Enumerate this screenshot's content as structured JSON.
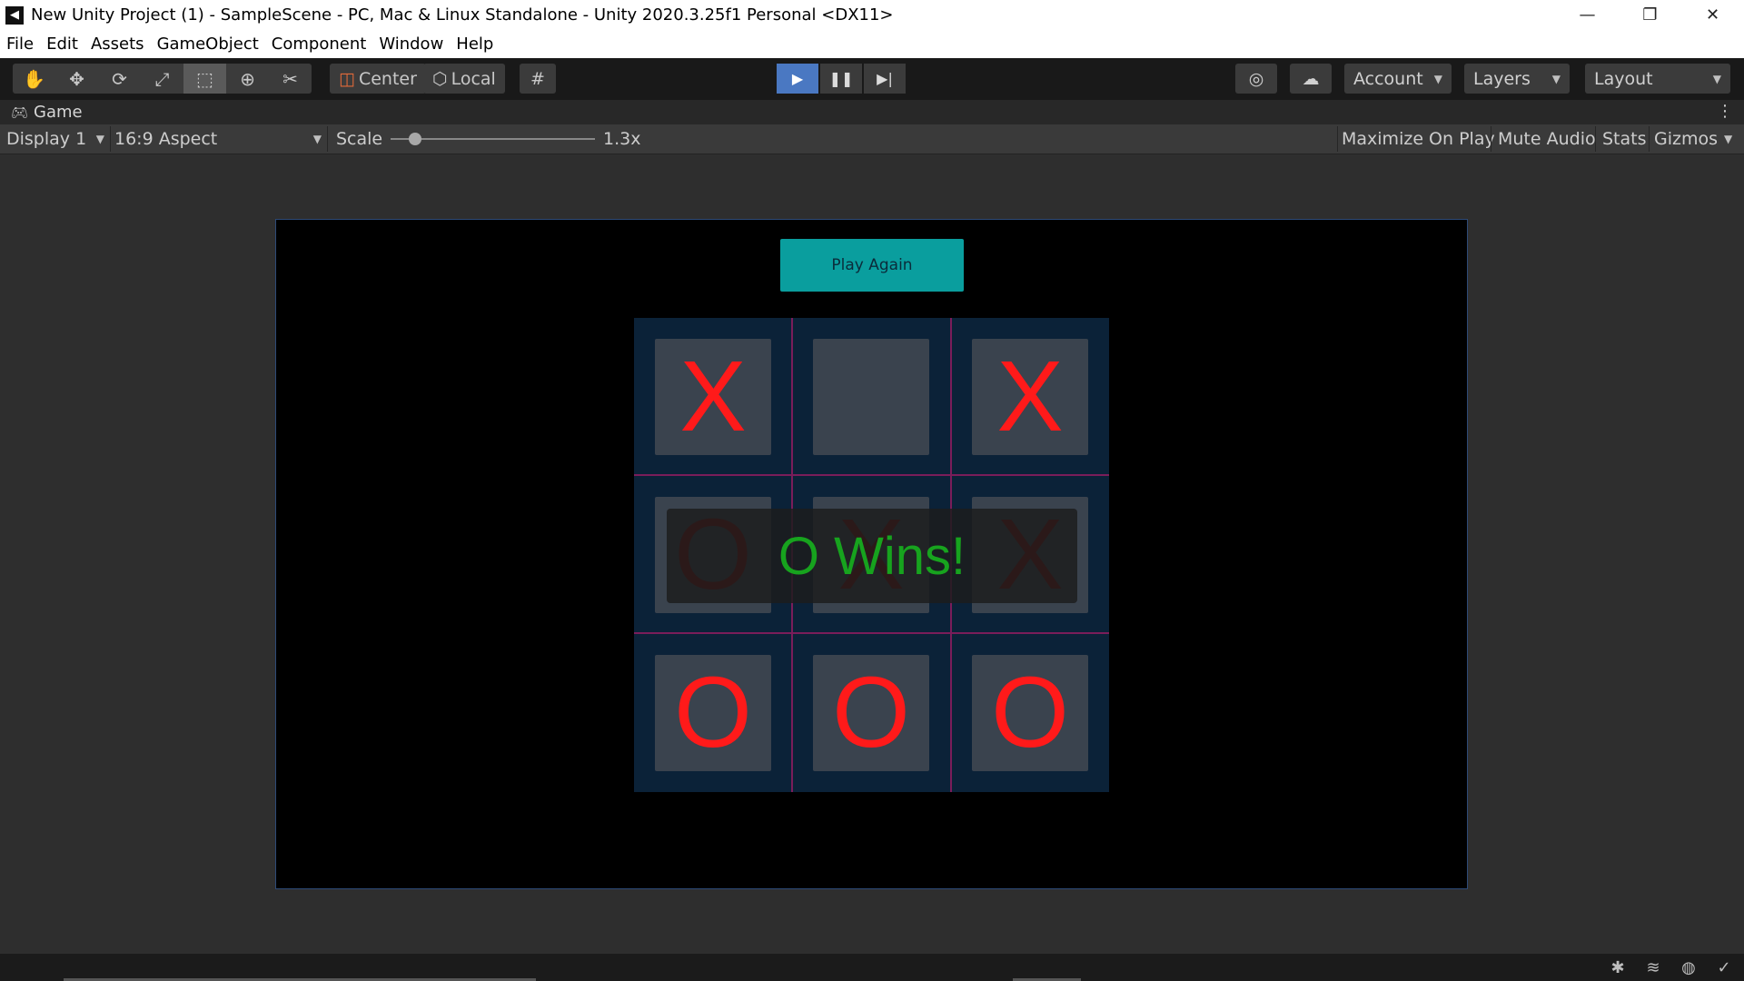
{
  "window": {
    "title": "New Unity Project (1) - SampleScene - PC, Mac & Linux Standalone - Unity 2020.3.25f1 Personal <DX11>",
    "controls": [
      "minimize-icon",
      "restore-icon",
      "close-icon"
    ]
  },
  "menu": [
    "File",
    "Edit",
    "Assets",
    "GameObject",
    "Component",
    "Window",
    "Help"
  ],
  "toolbar": {
    "tools": [
      "hand-icon",
      "move-icon",
      "rotate-icon",
      "scale-icon",
      "rect-icon",
      "transform-icon",
      "custom-tool-icon"
    ],
    "active_tool": "rect-icon",
    "pivot_label": "Center",
    "space_label": "Local",
    "account_label": "Account",
    "layers_label": "Layers",
    "layout_label": "Layout",
    "play_active": true
  },
  "game_tab": {
    "label": "Game",
    "display": "Display 1",
    "aspect": "16:9 Aspect",
    "scale_label": "Scale",
    "scale_value": "1.3x",
    "scale_fraction": 0.12,
    "maximize": "Maximize On Play",
    "mute": "Mute Audio",
    "stats": "Stats",
    "gizmos": "Gizmos"
  },
  "game": {
    "play_again_label": "Play Again",
    "board": [
      [
        "X",
        "",
        "X"
      ],
      [
        "O",
        "X",
        "X"
      ],
      [
        "O",
        "O",
        "O"
      ]
    ],
    "win_text": "O Wins!",
    "colors": {
      "mark": "#ff1a1a",
      "win": "#17a31e",
      "button": "#0a9e9e"
    }
  }
}
